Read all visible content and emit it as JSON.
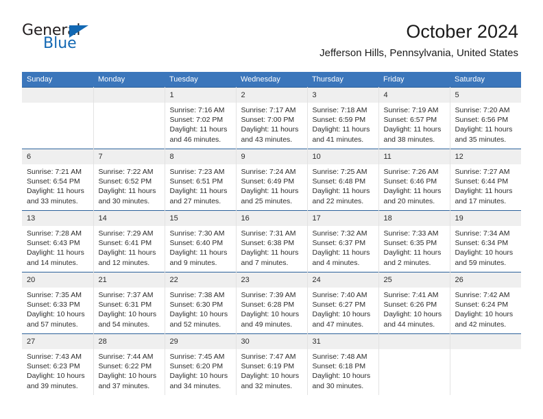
{
  "brand": {
    "name_part1": "General",
    "name_part2": "Blue",
    "triangle_color": "#1268b3"
  },
  "header": {
    "title": "October 2024",
    "subtitle": "Jefferson Hills, Pennsylvania, United States"
  },
  "colors": {
    "header_blue": "#3b76bb",
    "row_rule": "#2a6099",
    "daynum_band": "#efefef"
  },
  "weekday_headers": [
    "Sunday",
    "Monday",
    "Tuesday",
    "Wednesday",
    "Thursday",
    "Friday",
    "Saturday"
  ],
  "weeks": [
    [
      {
        "day": "",
        "sunrise": "",
        "sunset": "",
        "daylight": ""
      },
      {
        "day": "",
        "sunrise": "",
        "sunset": "",
        "daylight": ""
      },
      {
        "day": "1",
        "sunrise": "Sunrise: 7:16 AM",
        "sunset": "Sunset: 7:02 PM",
        "daylight": "Daylight: 11 hours and 46 minutes."
      },
      {
        "day": "2",
        "sunrise": "Sunrise: 7:17 AM",
        "sunset": "Sunset: 7:00 PM",
        "daylight": "Daylight: 11 hours and 43 minutes."
      },
      {
        "day": "3",
        "sunrise": "Sunrise: 7:18 AM",
        "sunset": "Sunset: 6:59 PM",
        "daylight": "Daylight: 11 hours and 41 minutes."
      },
      {
        "day": "4",
        "sunrise": "Sunrise: 7:19 AM",
        "sunset": "Sunset: 6:57 PM",
        "daylight": "Daylight: 11 hours and 38 minutes."
      },
      {
        "day": "5",
        "sunrise": "Sunrise: 7:20 AM",
        "sunset": "Sunset: 6:56 PM",
        "daylight": "Daylight: 11 hours and 35 minutes."
      }
    ],
    [
      {
        "day": "6",
        "sunrise": "Sunrise: 7:21 AM",
        "sunset": "Sunset: 6:54 PM",
        "daylight": "Daylight: 11 hours and 33 minutes."
      },
      {
        "day": "7",
        "sunrise": "Sunrise: 7:22 AM",
        "sunset": "Sunset: 6:52 PM",
        "daylight": "Daylight: 11 hours and 30 minutes."
      },
      {
        "day": "8",
        "sunrise": "Sunrise: 7:23 AM",
        "sunset": "Sunset: 6:51 PM",
        "daylight": "Daylight: 11 hours and 27 minutes."
      },
      {
        "day": "9",
        "sunrise": "Sunrise: 7:24 AM",
        "sunset": "Sunset: 6:49 PM",
        "daylight": "Daylight: 11 hours and 25 minutes."
      },
      {
        "day": "10",
        "sunrise": "Sunrise: 7:25 AM",
        "sunset": "Sunset: 6:48 PM",
        "daylight": "Daylight: 11 hours and 22 minutes."
      },
      {
        "day": "11",
        "sunrise": "Sunrise: 7:26 AM",
        "sunset": "Sunset: 6:46 PM",
        "daylight": "Daylight: 11 hours and 20 minutes."
      },
      {
        "day": "12",
        "sunrise": "Sunrise: 7:27 AM",
        "sunset": "Sunset: 6:44 PM",
        "daylight": "Daylight: 11 hours and 17 minutes."
      }
    ],
    [
      {
        "day": "13",
        "sunrise": "Sunrise: 7:28 AM",
        "sunset": "Sunset: 6:43 PM",
        "daylight": "Daylight: 11 hours and 14 minutes."
      },
      {
        "day": "14",
        "sunrise": "Sunrise: 7:29 AM",
        "sunset": "Sunset: 6:41 PM",
        "daylight": "Daylight: 11 hours and 12 minutes."
      },
      {
        "day": "15",
        "sunrise": "Sunrise: 7:30 AM",
        "sunset": "Sunset: 6:40 PM",
        "daylight": "Daylight: 11 hours and 9 minutes."
      },
      {
        "day": "16",
        "sunrise": "Sunrise: 7:31 AM",
        "sunset": "Sunset: 6:38 PM",
        "daylight": "Daylight: 11 hours and 7 minutes."
      },
      {
        "day": "17",
        "sunrise": "Sunrise: 7:32 AM",
        "sunset": "Sunset: 6:37 PM",
        "daylight": "Daylight: 11 hours and 4 minutes."
      },
      {
        "day": "18",
        "sunrise": "Sunrise: 7:33 AM",
        "sunset": "Sunset: 6:35 PM",
        "daylight": "Daylight: 11 hours and 2 minutes."
      },
      {
        "day": "19",
        "sunrise": "Sunrise: 7:34 AM",
        "sunset": "Sunset: 6:34 PM",
        "daylight": "Daylight: 10 hours and 59 minutes."
      }
    ],
    [
      {
        "day": "20",
        "sunrise": "Sunrise: 7:35 AM",
        "sunset": "Sunset: 6:33 PM",
        "daylight": "Daylight: 10 hours and 57 minutes."
      },
      {
        "day": "21",
        "sunrise": "Sunrise: 7:37 AM",
        "sunset": "Sunset: 6:31 PM",
        "daylight": "Daylight: 10 hours and 54 minutes."
      },
      {
        "day": "22",
        "sunrise": "Sunrise: 7:38 AM",
        "sunset": "Sunset: 6:30 PM",
        "daylight": "Daylight: 10 hours and 52 minutes."
      },
      {
        "day": "23",
        "sunrise": "Sunrise: 7:39 AM",
        "sunset": "Sunset: 6:28 PM",
        "daylight": "Daylight: 10 hours and 49 minutes."
      },
      {
        "day": "24",
        "sunrise": "Sunrise: 7:40 AM",
        "sunset": "Sunset: 6:27 PM",
        "daylight": "Daylight: 10 hours and 47 minutes."
      },
      {
        "day": "25",
        "sunrise": "Sunrise: 7:41 AM",
        "sunset": "Sunset: 6:26 PM",
        "daylight": "Daylight: 10 hours and 44 minutes."
      },
      {
        "day": "26",
        "sunrise": "Sunrise: 7:42 AM",
        "sunset": "Sunset: 6:24 PM",
        "daylight": "Daylight: 10 hours and 42 minutes."
      }
    ],
    [
      {
        "day": "27",
        "sunrise": "Sunrise: 7:43 AM",
        "sunset": "Sunset: 6:23 PM",
        "daylight": "Daylight: 10 hours and 39 minutes."
      },
      {
        "day": "28",
        "sunrise": "Sunrise: 7:44 AM",
        "sunset": "Sunset: 6:22 PM",
        "daylight": "Daylight: 10 hours and 37 minutes."
      },
      {
        "day": "29",
        "sunrise": "Sunrise: 7:45 AM",
        "sunset": "Sunset: 6:20 PM",
        "daylight": "Daylight: 10 hours and 34 minutes."
      },
      {
        "day": "30",
        "sunrise": "Sunrise: 7:47 AM",
        "sunset": "Sunset: 6:19 PM",
        "daylight": "Daylight: 10 hours and 32 minutes."
      },
      {
        "day": "31",
        "sunrise": "Sunrise: 7:48 AM",
        "sunset": "Sunset: 6:18 PM",
        "daylight": "Daylight: 10 hours and 30 minutes."
      },
      {
        "day": "",
        "sunrise": "",
        "sunset": "",
        "daylight": ""
      },
      {
        "day": "",
        "sunrise": "",
        "sunset": "",
        "daylight": ""
      }
    ]
  ]
}
